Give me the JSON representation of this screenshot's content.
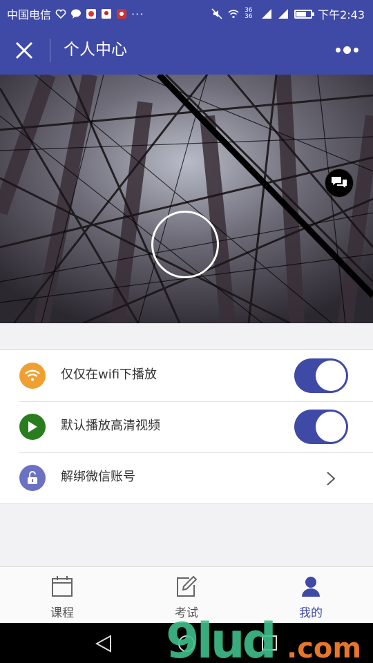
{
  "status_bar": {
    "carrier": "中国电信",
    "overflow": "···",
    "signal_label": "36 36",
    "time": "下午2:43",
    "battery_level": 0.8
  },
  "nav": {
    "title": "个人中心",
    "close_icon": "close-icon",
    "more_icon": "more-icon"
  },
  "profile": {
    "avatar_icon": "avatar-placeholder",
    "chat_icon": "chat-bubbles-icon"
  },
  "settings": [
    {
      "label": "仅仅在wifi下播放",
      "icon": "wifi-icon",
      "icon_color": "#f0a030",
      "control": "toggle",
      "on": true
    },
    {
      "label": "默认播放高清视频",
      "icon": "play-icon",
      "icon_color": "#2a7d1e",
      "control": "toggle",
      "on": true
    },
    {
      "label": "解绑微信账号",
      "icon": "unlock-icon",
      "icon_color": "#6b72c4",
      "control": "chevron"
    }
  ],
  "tabs": [
    {
      "label": "课程",
      "icon": "calendar-icon",
      "active": false
    },
    {
      "label": "考试",
      "icon": "edit-icon",
      "active": false
    },
    {
      "label": "我的",
      "icon": "person-icon",
      "active": true
    }
  ],
  "watermark": {
    "text": "9lud",
    "suffix": ".com"
  },
  "colors": {
    "primary": "#3f4aa6",
    "background": "#f2f2f4"
  }
}
